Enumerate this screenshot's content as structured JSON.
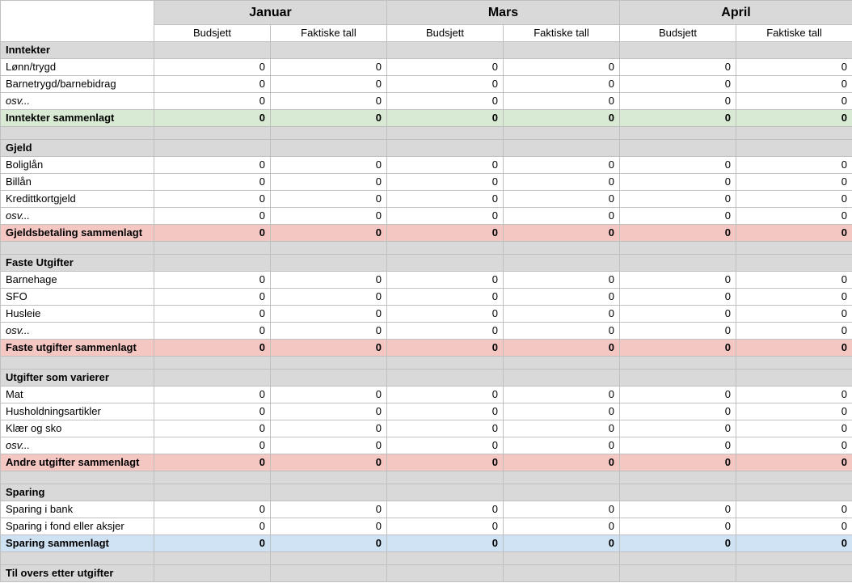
{
  "months": [
    "Januar",
    "Mars",
    "April"
  ],
  "subcols": [
    "Budsjett",
    "Faktiske tall"
  ],
  "sections": [
    {
      "title": "Inntekter",
      "rows": [
        {
          "label": "Lønn/trygd",
          "vals": [
            0,
            0,
            0,
            0,
            0,
            0
          ]
        },
        {
          "label": "Barnetrygd/barnebidrag",
          "vals": [
            0,
            0,
            0,
            0,
            0,
            0
          ]
        },
        {
          "label": "osv...",
          "italic": true,
          "vals": [
            0,
            0,
            0,
            0,
            0,
            0
          ]
        }
      ],
      "sum": {
        "label": "Inntekter sammenlagt",
        "vals": [
          0,
          0,
          0,
          0,
          0,
          0
        ],
        "color": "green"
      }
    },
    {
      "title": "Gjeld",
      "rows": [
        {
          "label": "Boliglån",
          "vals": [
            0,
            0,
            0,
            0,
            0,
            0
          ]
        },
        {
          "label": "Billån",
          "vals": [
            0,
            0,
            0,
            0,
            0,
            0
          ]
        },
        {
          "label": "Kredittkortgjeld",
          "vals": [
            0,
            0,
            0,
            0,
            0,
            0
          ]
        },
        {
          "label": "osv...",
          "italic": true,
          "vals": [
            0,
            0,
            0,
            0,
            0,
            0
          ]
        }
      ],
      "sum": {
        "label": "Gjeldsbetaling sammenlagt",
        "vals": [
          0,
          0,
          0,
          0,
          0,
          0
        ],
        "color": "red"
      }
    },
    {
      "title": "Faste Utgifter",
      "rows": [
        {
          "label": "Barnehage",
          "vals": [
            0,
            0,
            0,
            0,
            0,
            0
          ]
        },
        {
          "label": "SFO",
          "vals": [
            0,
            0,
            0,
            0,
            0,
            0
          ]
        },
        {
          "label": "Husleie",
          "vals": [
            0,
            0,
            0,
            0,
            0,
            0
          ]
        },
        {
          "label": "osv...",
          "italic": true,
          "vals": [
            0,
            0,
            0,
            0,
            0,
            0
          ]
        }
      ],
      "sum": {
        "label": "Faste utgifter sammenlagt",
        "vals": [
          0,
          0,
          0,
          0,
          0,
          0
        ],
        "color": "red"
      }
    },
    {
      "title": "Utgifter som varierer",
      "rows": [
        {
          "label": "Mat",
          "vals": [
            0,
            0,
            0,
            0,
            0,
            0
          ]
        },
        {
          "label": "Husholdningsartikler",
          "vals": [
            0,
            0,
            0,
            0,
            0,
            0
          ]
        },
        {
          "label": "Klær og sko",
          "vals": [
            0,
            0,
            0,
            0,
            0,
            0
          ]
        },
        {
          "label": "osv...",
          "italic": true,
          "vals": [
            0,
            0,
            0,
            0,
            0,
            0
          ]
        }
      ],
      "sum": {
        "label": "Andre utgifter sammenlagt",
        "vals": [
          0,
          0,
          0,
          0,
          0,
          0
        ],
        "color": "red"
      }
    },
    {
      "title": "Sparing",
      "rows": [
        {
          "label": "Sparing i bank",
          "vals": [
            0,
            0,
            0,
            0,
            0,
            0
          ]
        },
        {
          "label": "Sparing i fond eller aksjer",
          "vals": [
            0,
            0,
            0,
            0,
            0,
            0
          ]
        }
      ],
      "sum": {
        "label": "Sparing sammenlagt",
        "vals": [
          0,
          0,
          0,
          0,
          0,
          0
        ],
        "color": "blue"
      }
    }
  ],
  "footer": {
    "label": "Til overs etter utgifter"
  }
}
